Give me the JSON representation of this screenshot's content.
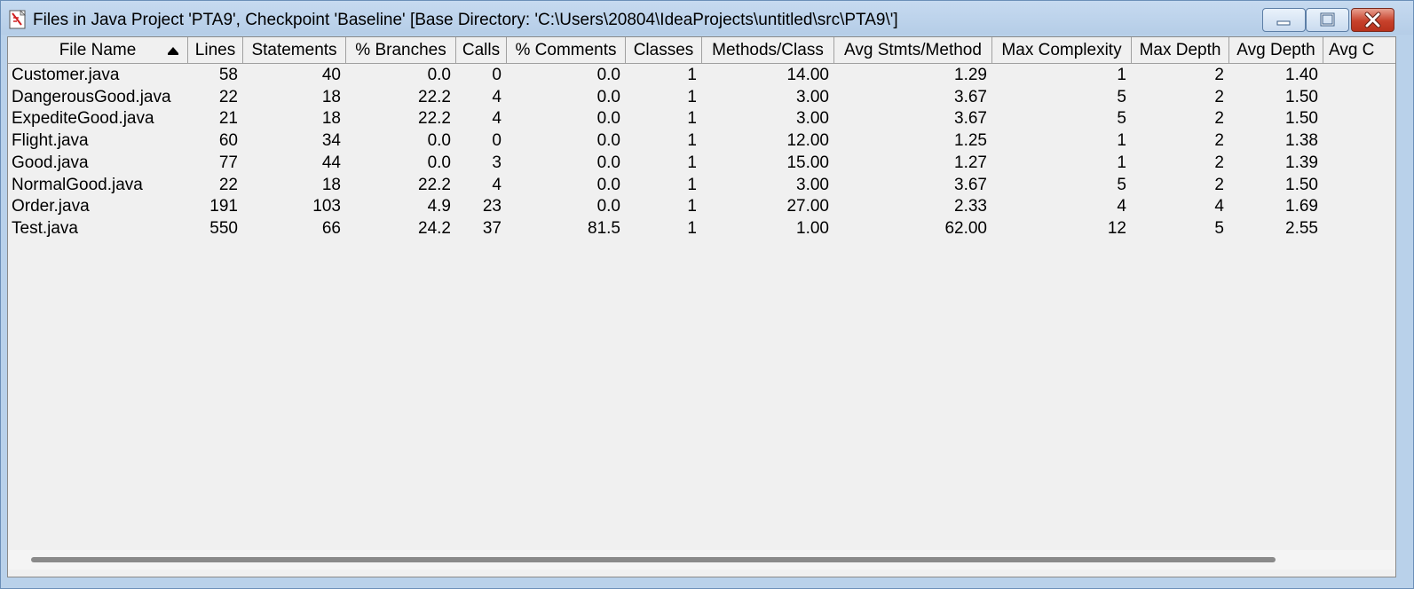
{
  "window": {
    "title": "Files in Java Project 'PTA9', Checkpoint 'Baseline'  [Base Directory: 'C:\\Users\\20804\\IdeaProjects\\untitled\\src\\PTA9\\']"
  },
  "table": {
    "columns": [
      "File Name",
      "Lines",
      "Statements",
      "% Branches",
      "Calls",
      "% Comments",
      "Classes",
      "Methods/Class",
      "Avg Stmts/Method",
      "Max Complexity",
      "Max Depth",
      "Avg Depth",
      "Avg C"
    ],
    "sorted_column": "File Name",
    "rows": [
      [
        "Customer.java",
        "58",
        "40",
        "0.0",
        "0",
        "0.0",
        "1",
        "14.00",
        "1.29",
        "1",
        "2",
        "1.40",
        ""
      ],
      [
        "DangerousGood.java",
        "22",
        "18",
        "22.2",
        "4",
        "0.0",
        "1",
        "3.00",
        "3.67",
        "5",
        "2",
        "1.50",
        ""
      ],
      [
        "ExpediteGood.java",
        "21",
        "18",
        "22.2",
        "4",
        "0.0",
        "1",
        "3.00",
        "3.67",
        "5",
        "2",
        "1.50",
        ""
      ],
      [
        "Flight.java",
        "60",
        "34",
        "0.0",
        "0",
        "0.0",
        "1",
        "12.00",
        "1.25",
        "1",
        "2",
        "1.38",
        ""
      ],
      [
        "Good.java",
        "77",
        "44",
        "0.0",
        "3",
        "0.0",
        "1",
        "15.00",
        "1.27",
        "1",
        "2",
        "1.39",
        ""
      ],
      [
        "NormalGood.java",
        "22",
        "18",
        "22.2",
        "4",
        "0.0",
        "1",
        "3.00",
        "3.67",
        "5",
        "2",
        "1.50",
        ""
      ],
      [
        "Order.java",
        "191",
        "103",
        "4.9",
        "23",
        "0.0",
        "1",
        "27.00",
        "2.33",
        "4",
        "4",
        "1.69",
        ""
      ],
      [
        "Test.java",
        "550",
        "66",
        "24.2",
        "37",
        "81.5",
        "1",
        "1.00",
        "62.00",
        "12",
        "5",
        "2.55",
        ""
      ]
    ]
  },
  "scrollbar": {
    "horizontal_position_fraction": 0.0
  }
}
